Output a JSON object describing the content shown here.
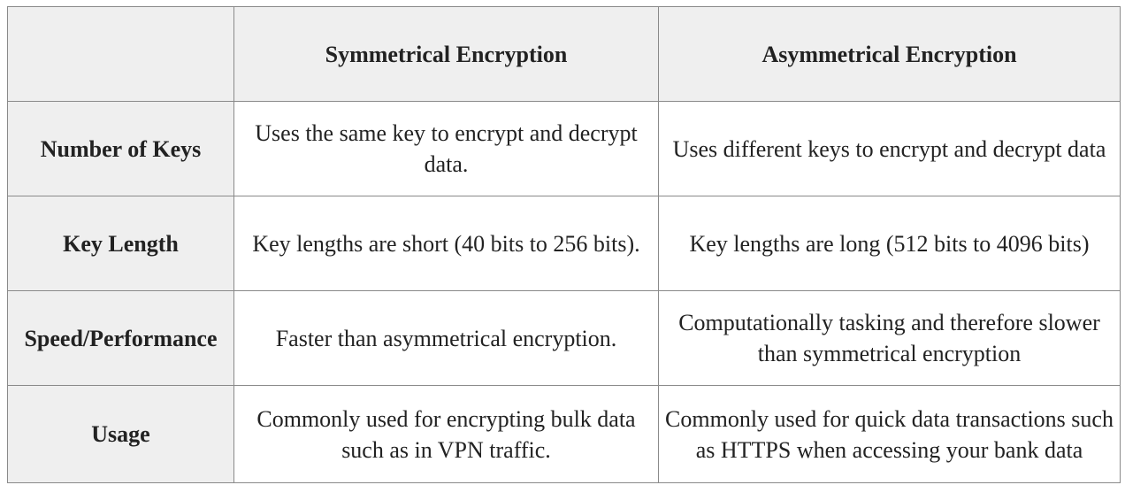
{
  "table": {
    "headers": [
      "",
      "Symmetrical Encryption",
      "Asymmetrical Encryption"
    ],
    "rows": [
      {
        "label": "Number of Keys",
        "symmetrical": "Uses the same key to encrypt and decrypt data.",
        "asymmetrical": "Uses different keys to encrypt and decrypt data"
      },
      {
        "label": "Key Length",
        "symmetrical": "Key lengths are short (40 bits to 256 bits).",
        "asymmetrical": "Key lengths are long (512 bits to 4096 bits)"
      },
      {
        "label": "Speed/Performance",
        "symmetrical": "Faster than asymmetrical encryption.",
        "asymmetrical": "Computationally tasking and therefore slower than symmetrical encryption"
      },
      {
        "label": "Usage",
        "symmetrical": "Commonly used for encrypting bulk data such as in VPN traffic.",
        "asymmetrical": "Commonly used for quick data transactions such as HTTPS when accessing your bank data"
      }
    ]
  }
}
